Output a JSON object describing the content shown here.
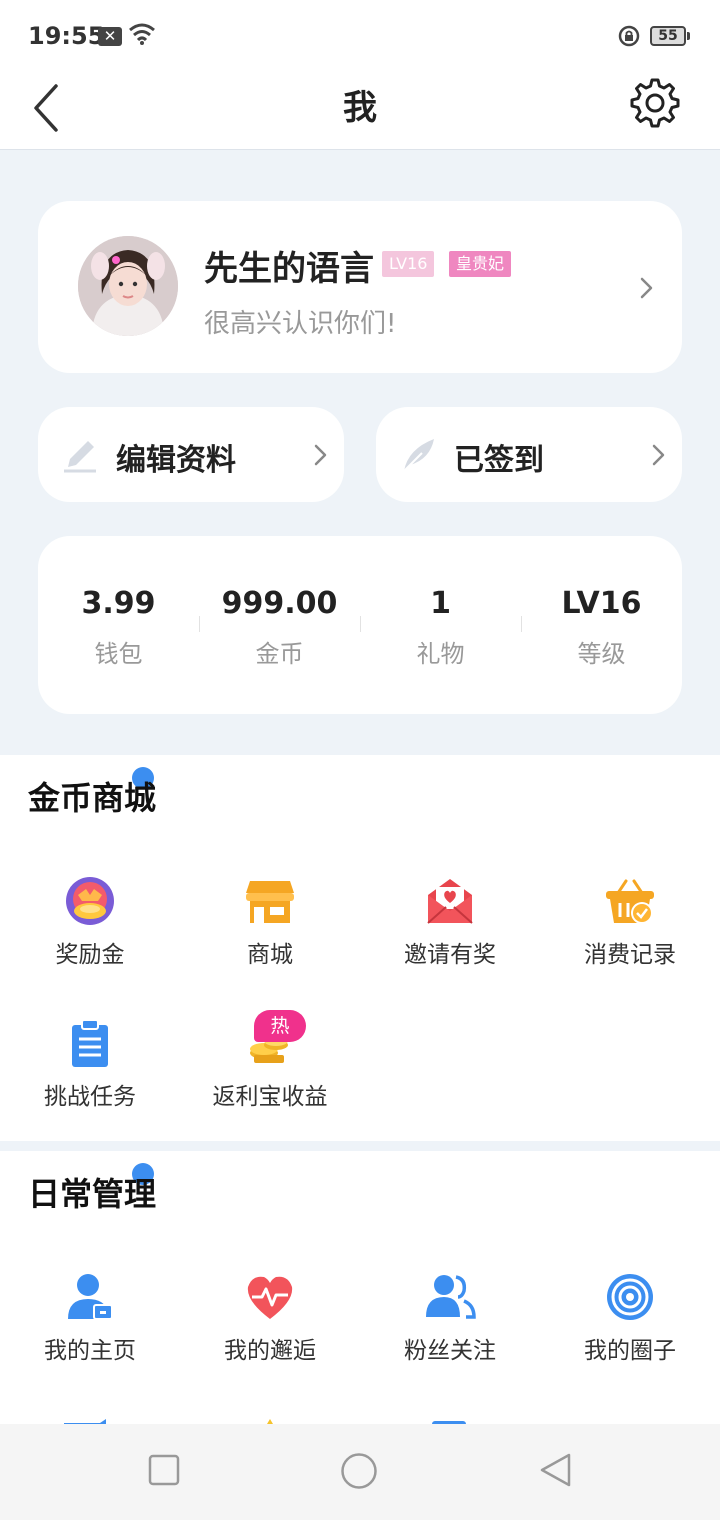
{
  "status_bar": {
    "time": "19:55",
    "notification_icon": "x-box-icon",
    "battery": "55"
  },
  "header": {
    "title": "我",
    "back_icon": "chevron-left-icon",
    "settings_icon": "gear-icon"
  },
  "profile": {
    "name": "先生的语言",
    "level_badge": "LV16",
    "title_badge": "皇贵妃",
    "bio": "很高兴认识你们!"
  },
  "actions": [
    {
      "label": "编辑资料",
      "icon": "pencil-icon"
    },
    {
      "label": "已签到",
      "icon": "feather-icon"
    }
  ],
  "stats": [
    {
      "value": "3.99",
      "label": "钱包"
    },
    {
      "value": "999.00",
      "label": "金币"
    },
    {
      "value": "1",
      "label": "礼物"
    },
    {
      "value": "LV16",
      "label": "等级"
    }
  ],
  "coin_shop": {
    "title": "金币商城",
    "items": [
      {
        "label": "奖励金",
        "icon": "reward-icon"
      },
      {
        "label": "商城",
        "icon": "store-icon"
      },
      {
        "label": "邀请有奖",
        "icon": "envelope-heart-icon"
      },
      {
        "label": "消费记录",
        "icon": "basket-check-icon"
      },
      {
        "label": "挑战任务",
        "icon": "clipboard-icon"
      },
      {
        "label": "返利宝收益",
        "icon": "gold-coins-icon"
      }
    ],
    "hot_badge": "热"
  },
  "daily": {
    "title": "日常管理",
    "items": [
      {
        "label": "我的主页",
        "icon": "user-home-icon"
      },
      {
        "label": "我的邂逅",
        "icon": "heartbeat-icon"
      },
      {
        "label": "粉丝关注",
        "icon": "followers-icon"
      },
      {
        "label": "我的圈子",
        "icon": "target-circle-icon"
      }
    ]
  },
  "colors": {
    "accent_blue": "#3c8ef0",
    "pink_badge": "#ef87c0",
    "hot_pink": "#f0318c",
    "orange": "#f5a623",
    "red": "#f2545b"
  }
}
